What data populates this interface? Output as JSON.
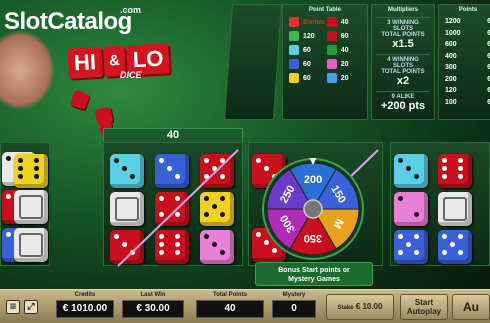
{
  "logo": {
    "brand_part1": "Slot",
    "brand_part2": "Catalog",
    "tld": ".com"
  },
  "game_title": {
    "hi": "HI",
    "amp": "&",
    "lo": "LO",
    "dice": "DICE"
  },
  "point_table": {
    "title": "Point Table",
    "rows": [
      {
        "left_label": "Bonus",
        "left_color": "#e83030",
        "right_value": "40",
        "right_color": "#c8101c"
      },
      {
        "left_label": "120",
        "left_color": "#3fb84a",
        "right_value": "60",
        "right_color": "#c8101c"
      },
      {
        "left_label": "60",
        "left_color": "#5ad0e8",
        "right_value": "40",
        "right_color": "#2a9a3a"
      },
      {
        "left_label": "60",
        "left_color": "#3a62d8",
        "right_value": "20",
        "right_color": "#e060c8"
      },
      {
        "left_label": "60",
        "left_color": "#f0d020",
        "right_value": "20",
        "right_color": "#4aa0e8"
      }
    ]
  },
  "multipliers": {
    "title": "Multipliers",
    "items": [
      {
        "line1": "3 WINNING SLOTS",
        "line2": "TOTAL POINTS",
        "value": "x1.5"
      },
      {
        "line1": "4 WINNING SLOTS",
        "line2": "TOTAL POINTS",
        "value": "x2"
      },
      {
        "line1": "9 ALIKE",
        "line2": "",
        "value": "+200 pts"
      }
    ]
  },
  "points_table": {
    "title": "Points",
    "rows": [
      {
        "pts": "1200",
        "prize": "€"
      },
      {
        "pts": "1000",
        "prize": "€"
      },
      {
        "pts": "600",
        "prize": "€"
      },
      {
        "pts": "400",
        "prize": "€"
      },
      {
        "pts": "300",
        "prize": "€"
      },
      {
        "pts": "200",
        "prize": "€"
      },
      {
        "pts": "120",
        "prize": "€"
      },
      {
        "pts": "100",
        "prize": "€"
      }
    ]
  },
  "reel_header": {
    "value": "40"
  },
  "wheel": {
    "segments": [
      "200",
      "150",
      "M",
      "350",
      "300",
      "250"
    ],
    "caption_line1": "Bonus Start points or",
    "caption_line2": "Mystery Games"
  },
  "bottom_bar": {
    "credits_label": "Credits",
    "credits_value": "€ 1010.00",
    "lastwin_label": "Last Win",
    "lastwin_value": "€ 30.00",
    "totalpoints_label": "Total Points",
    "totalpoints_value": "40",
    "mystery_label": "Mystery",
    "mystery_value": "0",
    "stake_label": "Stake",
    "stake_value": "€ 10.00",
    "autoplay_line1": "Start",
    "autoplay_line2": "Autoplay",
    "auto_label": "Au"
  },
  "colors": {
    "red": "#c8101c",
    "yellow": "#f0d020",
    "cyan": "#5ad0e8",
    "blue": "#3a62d8",
    "pink": "#e880d8",
    "white": "#e8e8e8",
    "felt": "#145226"
  }
}
